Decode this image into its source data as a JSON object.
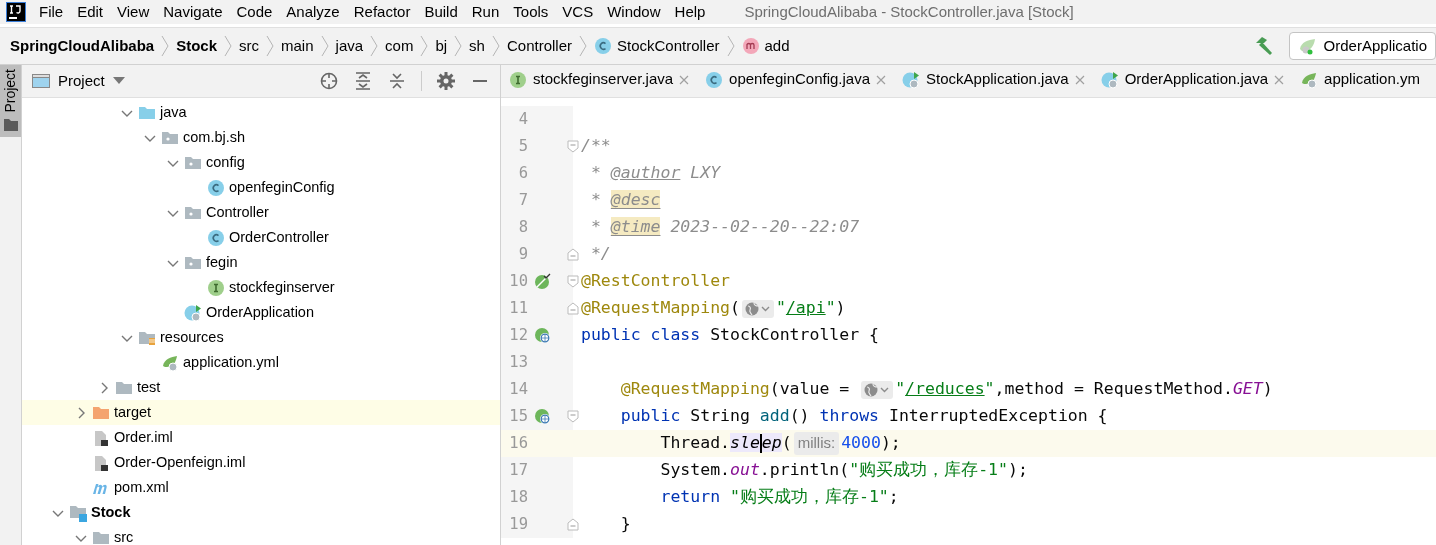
{
  "window": {
    "title": "SpringCloudAlibaba - StockController.java [Stock]"
  },
  "menu": [
    "File",
    "Edit",
    "View",
    "Navigate",
    "Code",
    "Analyze",
    "Refactor",
    "Build",
    "Run",
    "Tools",
    "VCS",
    "Window",
    "Help"
  ],
  "breadcrumbs": [
    {
      "label": "SpringCloudAlibaba",
      "kind": "project"
    },
    {
      "label": "Stock",
      "kind": "module"
    },
    {
      "label": "src",
      "kind": "dir"
    },
    {
      "label": "main",
      "kind": "dir"
    },
    {
      "label": "java",
      "kind": "dir"
    },
    {
      "label": "com",
      "kind": "dir"
    },
    {
      "label": "bj",
      "kind": "dir"
    },
    {
      "label": "sh",
      "kind": "dir"
    },
    {
      "label": "Controller",
      "kind": "dir"
    },
    {
      "label": "StockController",
      "kind": "class"
    },
    {
      "label": "add",
      "kind": "method"
    }
  ],
  "run_config": {
    "label": "OrderApplicatio"
  },
  "tool_stripe": {
    "label": "Project",
    "selected": true
  },
  "project_panel": {
    "title": "Project"
  },
  "tree": [
    {
      "children": [
        {
          "children": [
            {
              "children": [
                {
                  "label": "java",
                  "kind": "source-folder",
                  "expanded": true,
                  "highlighted": false,
                  "children": [
                    {
                      "label": "com.bj.sh",
                      "kind": "package",
                      "expanded": true,
                      "highlighted": false,
                      "children": [
                        {
                          "label": "config",
                          "kind": "package",
                          "expanded": true,
                          "highlighted": false,
                          "children": [
                            {
                              "label": "openfeginConfig",
                              "kind": "class",
                              "highlighted": false
                            }
                          ]
                        },
                        {
                          "label": "Controller",
                          "kind": "package",
                          "expanded": true,
                          "highlighted": false,
                          "children": [
                            {
                              "label": "OrderController",
                              "kind": "class",
                              "highlighted": false
                            }
                          ]
                        },
                        {
                          "label": "fegin",
                          "kind": "package",
                          "expanded": true,
                          "highlighted": false,
                          "children": [
                            {
                              "label": "stockfeginserver",
                              "kind": "interface",
                              "highlighted": false
                            }
                          ]
                        },
                        {
                          "label": "OrderApplication",
                          "kind": "boot-class",
                          "highlighted": false
                        }
                      ]
                    }
                  ]
                },
                {
                  "label": "resources",
                  "kind": "resources-folder",
                  "expanded": true,
                  "highlighted": false,
                  "children": [
                    {
                      "label": "application.yml",
                      "kind": "yaml",
                      "highlighted": false
                    }
                  ]
                }
              ]
            },
            {
              "label": "test",
              "kind": "folder",
              "expanded": false,
              "highlighted": false
            }
          ]
        },
        {
          "label": "target",
          "kind": "excluded-folder",
          "expanded": false,
          "highlighted": true
        },
        {
          "label": "Order.iml",
          "kind": "iml",
          "highlighted": false
        },
        {
          "label": "Order-Openfeign.iml",
          "kind": "iml",
          "highlighted": false
        },
        {
          "label": "pom.xml",
          "kind": "maven",
          "highlighted": false
        }
      ]
    },
    {
      "label": "Stock",
      "kind": "module",
      "expanded": true,
      "highlighted": false,
      "children": [
        {
          "label": "src",
          "kind": "folder",
          "expanded": true,
          "highlighted": false
        }
      ]
    }
  ],
  "editor_tabs": [
    {
      "label": "stockfeginserver.java",
      "kind": "interface",
      "selected": false,
      "closable": true
    },
    {
      "label": "openfeginConfig.java",
      "kind": "class",
      "selected": false,
      "closable": true
    },
    {
      "label": "StockApplication.java",
      "kind": "boot-class",
      "selected": false,
      "closable": true
    },
    {
      "label": "OrderApplication.java",
      "kind": "boot-class",
      "selected": false,
      "closable": true
    },
    {
      "label": "application.ym",
      "kind": "yaml",
      "selected": false,
      "closable": false
    }
  ],
  "code_lines": [
    {
      "number": "4",
      "current": false,
      "fold_start": false,
      "fold_end": false
    },
    {
      "number": "5",
      "current": false,
      "fold_start": true,
      "fold_end": false,
      "tokens": [
        {
          "kind": "comment",
          "text": "/**"
        }
      ]
    },
    {
      "number": "6",
      "current": false,
      "fold_start": false,
      "fold_end": false,
      "tokens": [
        {
          "kind": "comment",
          "text": " * "
        },
        {
          "kind": "doc-tag",
          "text": "@author"
        },
        {
          "kind": "comment",
          "text": " LXY"
        }
      ]
    },
    {
      "number": "7",
      "current": false,
      "fold_start": false,
      "fold_end": false,
      "tokens": [
        {
          "kind": "comment",
          "text": " * "
        },
        {
          "kind": "doc-tag-marked",
          "text": "@desc"
        }
      ]
    },
    {
      "number": "8",
      "current": false,
      "fold_start": false,
      "fold_end": false,
      "tokens": [
        {
          "kind": "comment",
          "text": " * "
        },
        {
          "kind": "doc-tag-marked",
          "text": "@time"
        },
        {
          "kind": "comment",
          "text": " 2023--02--20--22:07"
        }
      ]
    },
    {
      "number": "9",
      "current": false,
      "fold_start": false,
      "fold_end": true,
      "tokens": [
        {
          "kind": "comment",
          "text": " */"
        }
      ]
    },
    {
      "number": "10",
      "current": false,
      "fold_start": true,
      "fold_end": false,
      "gutter_icon": {
        "kind": "spring-bean"
      },
      "tokens": [
        {
          "kind": "annotation",
          "text": "@RestController"
        }
      ]
    },
    {
      "number": "11",
      "current": false,
      "fold_start": false,
      "fold_end": true,
      "tokens": [
        {
          "kind": "annotation",
          "text": "@RequestMapping"
        },
        {
          "kind": "plain",
          "text": "("
        },
        {
          "kind": "url-inlay"
        },
        {
          "kind": "string",
          "text": "\""
        },
        {
          "kind": "url",
          "text": "/api"
        },
        {
          "kind": "string",
          "text": "\""
        },
        {
          "kind": "plain",
          "text": ")"
        }
      ]
    },
    {
      "number": "12",
      "current": false,
      "fold_start": false,
      "fold_end": false,
      "gutter_icon": {
        "kind": "spring-web"
      },
      "tokens": [
        {
          "kind": "keyword",
          "text": "public class "
        },
        {
          "kind": "plain",
          "text": "StockController {"
        }
      ]
    },
    {
      "number": "13",
      "current": false,
      "fold_start": false,
      "fold_end": false
    },
    {
      "number": "14",
      "current": false,
      "fold_start": false,
      "fold_end": false,
      "tokens": [
        {
          "kind": "annotation",
          "text": "    @RequestMapping"
        },
        {
          "kind": "plain",
          "text": "(value = "
        },
        {
          "kind": "url-inlay"
        },
        {
          "kind": "string",
          "text": "\""
        },
        {
          "kind": "url",
          "text": "/reduces"
        },
        {
          "kind": "string",
          "text": "\""
        },
        {
          "kind": "plain",
          "text": ",method = RequestMethod."
        },
        {
          "kind": "static",
          "text": "GET"
        },
        {
          "kind": "plain",
          "text": ")"
        }
      ]
    },
    {
      "number": "15",
      "current": false,
      "fold_start": true,
      "fold_end": false,
      "gutter_icon": {
        "kind": "spring-web"
      },
      "tokens": [
        {
          "kind": "keyword",
          "text": "    public "
        },
        {
          "kind": "plain",
          "text": "String "
        },
        {
          "kind": "declaration",
          "text": "add"
        },
        {
          "kind": "plain",
          "text": "() "
        },
        {
          "kind": "keyword",
          "text": "throws "
        },
        {
          "kind": "plain",
          "text": "InterruptedException {"
        }
      ]
    },
    {
      "number": "16",
      "current": true,
      "fold_start": false,
      "fold_end": false,
      "tokens": [
        {
          "kind": "plain",
          "text": "        Thread."
        },
        {
          "kind": "static-call",
          "text": "sle"
        },
        {
          "kind": "caret"
        },
        {
          "kind": "static-call",
          "text": "ep"
        },
        {
          "kind": "plain",
          "text": "("
        },
        {
          "kind": "hint",
          "text": "millis:"
        },
        {
          "kind": "number",
          "text": "4000"
        },
        {
          "kind": "plain",
          "text": ");"
        }
      ]
    },
    {
      "number": "17",
      "current": false,
      "fold_start": false,
      "fold_end": false,
      "tokens": [
        {
          "kind": "plain",
          "text": "        System."
        },
        {
          "kind": "static",
          "text": "out"
        },
        {
          "kind": "plain",
          "text": ".println("
        },
        {
          "kind": "string",
          "text": "\"购买成功，库存-1\""
        },
        {
          "kind": "plain",
          "text": ");"
        }
      ]
    },
    {
      "number": "18",
      "current": false,
      "fold_start": false,
      "fold_end": false,
      "tokens": [
        {
          "kind": "keyword",
          "text": "        return "
        },
        {
          "kind": "string",
          "text": "\"购买成功，库存-1\""
        },
        {
          "kind": "plain",
          "text": ";"
        }
      ]
    },
    {
      "number": "19",
      "current": false,
      "fold_start": false,
      "fold_end": true,
      "tokens": [
        {
          "kind": "plain",
          "text": "    }"
        }
      ]
    }
  ]
}
